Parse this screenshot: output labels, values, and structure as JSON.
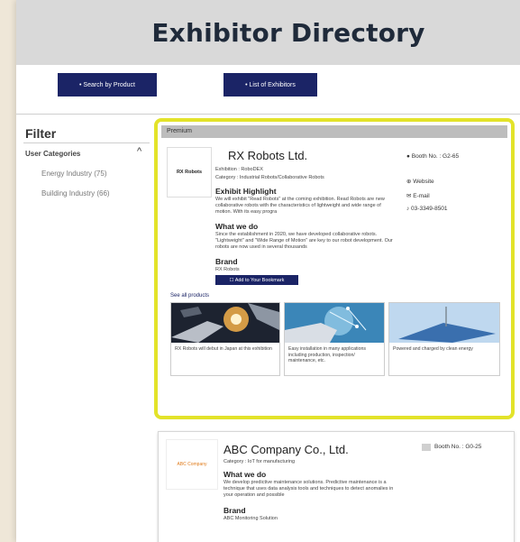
{
  "header": {
    "title": "Exhibitor Directory"
  },
  "nav": {
    "search_by_product": "• Search by Product",
    "list_of_exhibitors": "• List of Exhibitors"
  },
  "filter": {
    "title": "Filter",
    "category_label": "User Categories",
    "chevron": "^",
    "options": [
      "Energy Industry (75)",
      "Building Industry (66)"
    ]
  },
  "premium": {
    "bar_label": "Premium",
    "logo_text": "RX Robots",
    "company": "RX Robots Ltd.",
    "exhibition": "Exhibition : RoboDEX",
    "category": "Category : Industrial Robots/Collaborative Robots",
    "highlight_heading": "Exhibit Highlight",
    "highlight_text": "We will exhibit \"Read Robots\" at the coming exhibition. Read Robots are new collaborative robots with the characteristics of lightweight and wide range of motion. With its easy progra",
    "whatwedo_heading": "What we do",
    "whatwedo_text": "Since the establishment in 2020, we have developed collaborative robots. \"Lightweight\" and \"Wide Range of Motion\" are key to our robot development. Our robots are now used in several thousands",
    "brand_heading": "Brand",
    "brand_value": "RX Robots",
    "bookmark_label": "☐ Add to Your Bookmark",
    "booth": "● Booth No. : G2-65",
    "website": "⊕ Website",
    "email": "✉ E-mail",
    "phone": "♪ 03-3349-8501",
    "see_all": "See all products",
    "products": [
      {
        "caption": "RX Robots will debut in Japan at this exhibition"
      },
      {
        "caption": "Easy installation in many applications including production, inspection/ maintenance, etc."
      },
      {
        "caption": "Powered and charged by clean energy"
      }
    ]
  },
  "card2": {
    "logo_text": "ABC Company",
    "company": "ABC Company Co., Ltd.",
    "category": "Category : IoT for manufacturing",
    "whatwedo_heading": "What we do",
    "whatwedo_text": "We develop predictive maintenance solutions. Predictive maintenance is a technique that uses data analysis tools and techniques to detect anomalies in your operation and possible",
    "brand_heading": "Brand",
    "brand_value": "ABC Monitoring Solution",
    "booth": "Booth No. : G0-25"
  },
  "colors": {
    "navy": "#1b2466",
    "highlight": "#e3e32a",
    "header_bg": "#d9d9d9"
  }
}
